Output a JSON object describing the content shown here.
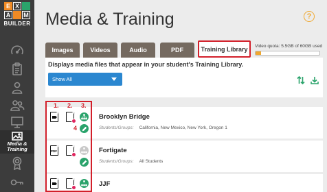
{
  "brand": {
    "logo_letters": [
      "E",
      "X",
      "",
      "A",
      "",
      "M"
    ],
    "wordmark": "BUILDER",
    "colors": {
      "orange": "#f08a24",
      "green": "#2aa36b",
      "blue": "#2b87d0",
      "red": "#d21f2a",
      "tab_brown": "#756a60"
    }
  },
  "sidebar": {
    "items": [
      {
        "icon": "speedometer-icon"
      },
      {
        "icon": "clipboard-icon"
      },
      {
        "icon": "person-icon"
      },
      {
        "icon": "people-icon"
      },
      {
        "icon": "presentation-icon"
      },
      {
        "icon": "media-image-icon",
        "label_line1": "Media &",
        "label_line2": "Training",
        "active": true
      },
      {
        "icon": "badge-icon"
      },
      {
        "icon": "key-icon"
      }
    ]
  },
  "page": {
    "title": "Media & Training",
    "help_symbol": "?"
  },
  "tabs": [
    {
      "label": "Images"
    },
    {
      "label": "Videos"
    },
    {
      "label": "Audio"
    },
    {
      "label": "PDF"
    },
    {
      "label": "Training Library",
      "active": true
    }
  ],
  "quota": {
    "label": "Video quota: 5.5GB of 60GB used",
    "used_fraction": 0.09
  },
  "panel": {
    "description": "Displays media files that appear in your student's Training Library.",
    "filter": {
      "selected": "Show All"
    },
    "tools": [
      "sort-icon",
      "download-icon"
    ]
  },
  "annotations": [
    "1.",
    "2.",
    "3.",
    "4"
  ],
  "items": [
    {
      "title": "Brooklyn Bridge",
      "sub_label": "Students/Groups:",
      "sub_value": "California, New Mexico, New York, Oregon 1",
      "file_type": "video",
      "assigned": true
    },
    {
      "title": "Fortigate",
      "sub_label": "Students/Groups:",
      "sub_value": "All Students",
      "file_type": "pdf",
      "assigned": false
    },
    {
      "title": "JJF",
      "sub_label": "",
      "sub_value": "",
      "file_type": "video",
      "assigned": true
    }
  ]
}
